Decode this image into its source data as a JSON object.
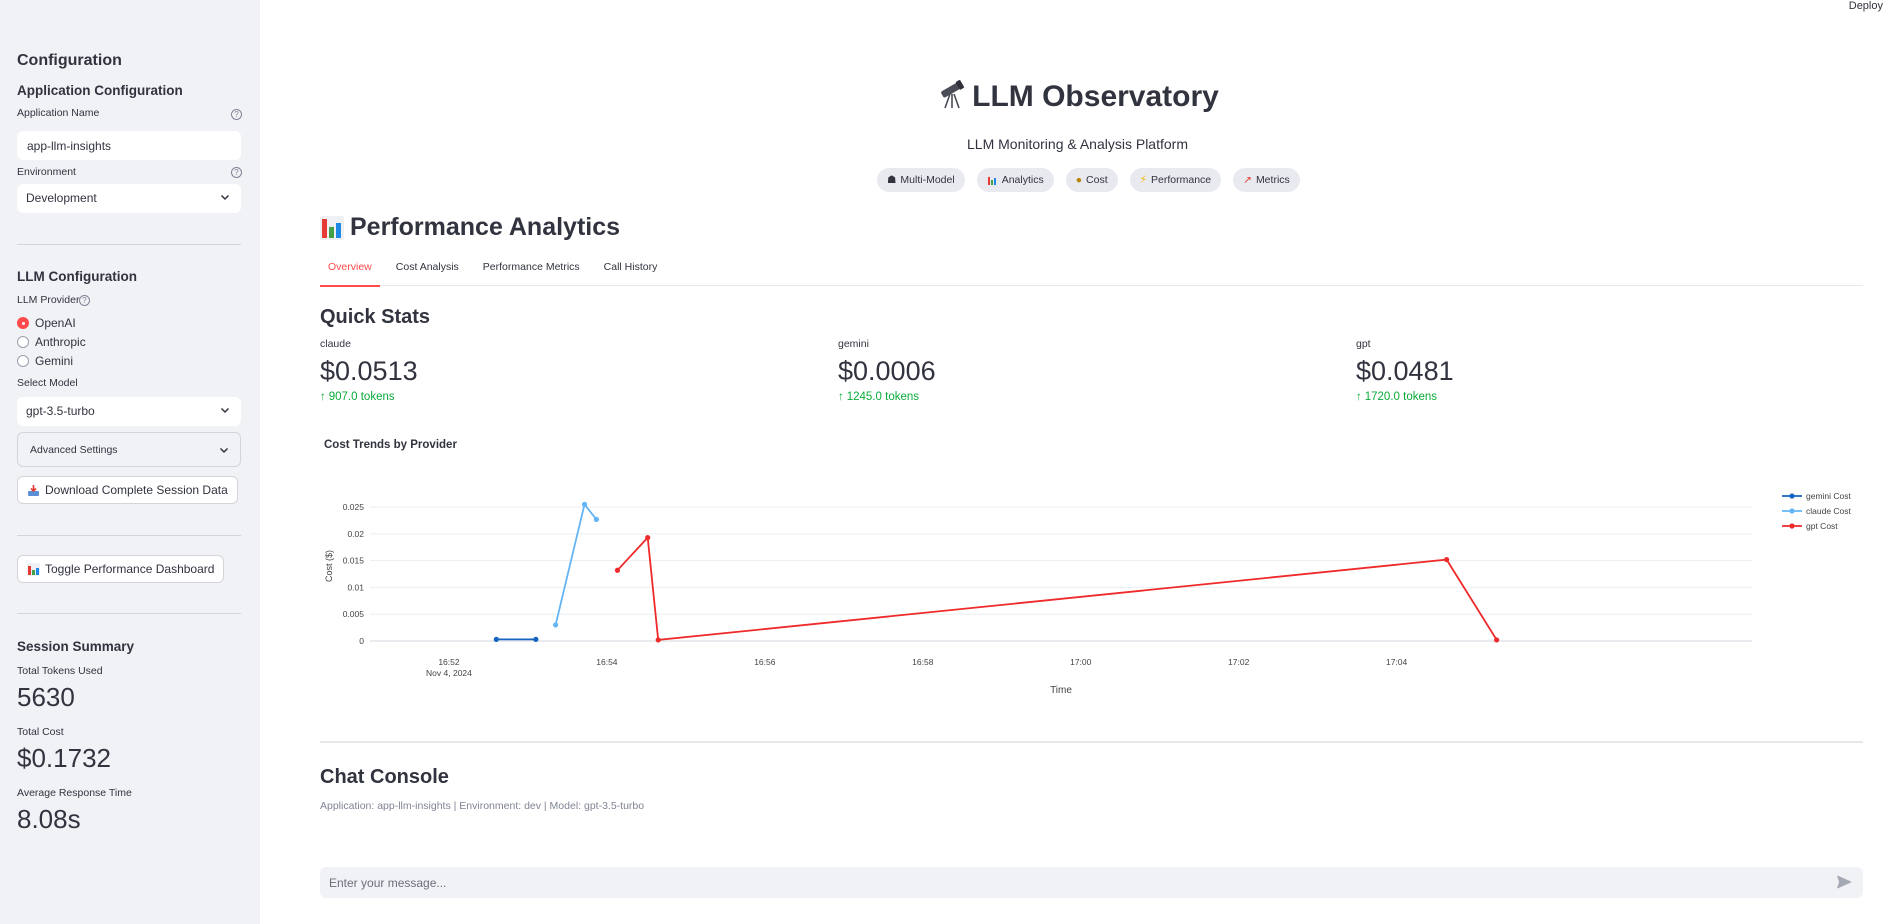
{
  "header": {
    "deploy_label": "Deploy"
  },
  "sidebar": {
    "title": "Configuration",
    "app_config_heading": "Application Configuration",
    "app_name_label": "Application Name",
    "app_name_value": "app-llm-insights",
    "environment_label": "Environment",
    "environment_value": "Development",
    "llm_config_heading": "LLM Configuration",
    "provider_label": "LLM Provider",
    "providers": [
      {
        "label": "OpenAI",
        "selected": true
      },
      {
        "label": "Anthropic",
        "selected": false
      },
      {
        "label": "Gemini",
        "selected": false
      }
    ],
    "model_label": "Select Model",
    "model_value": "gpt-3.5-turbo",
    "advanced_label": "Advanced Settings",
    "download_label": "Download Complete Session Data",
    "toggle_label": "Toggle Performance Dashboard",
    "summary_heading": "Session Summary",
    "tokens_label": "Total Tokens Used",
    "tokens_value": "5630",
    "cost_label": "Total Cost",
    "cost_value": "$0.1732",
    "response_label": "Average Response Time",
    "response_value": "8.08s"
  },
  "main": {
    "title": "LLM Observatory",
    "subtitle": "LLM Monitoring & Analysis Platform",
    "pills": [
      {
        "icon": "robot-icon",
        "label": "Multi-Model"
      },
      {
        "icon": "bar-chart-icon",
        "label": "Analytics"
      },
      {
        "icon": "money-bag-icon",
        "label": "Cost"
      },
      {
        "icon": "lightning-icon",
        "label": "Performance"
      },
      {
        "icon": "trend-icon",
        "label": "Metrics"
      }
    ],
    "section_title": "Performance Analytics",
    "tabs": [
      {
        "label": "Overview",
        "active": true
      },
      {
        "label": "Cost Analysis",
        "active": false
      },
      {
        "label": "Performance Metrics",
        "active": false
      },
      {
        "label": "Call History",
        "active": false
      }
    ],
    "quick_stats_heading": "Quick Stats",
    "stats": [
      {
        "label": "claude",
        "value": "$0.0513",
        "delta": "907.0 tokens"
      },
      {
        "label": "gemini",
        "value": "$0.0006",
        "delta": "1245.0 tokens"
      },
      {
        "label": "gpt",
        "value": "$0.0481",
        "delta": "1720.0 tokens"
      }
    ],
    "chat_heading": "Chat Console",
    "chat_caption": "Application: app-llm-insights | Environment: dev | Model: gpt-3.5-turbo",
    "chat_placeholder": "Enter your message..."
  },
  "colors": {
    "accent": "#ff4b4b",
    "positive": "#09ab3b",
    "gemini": "#1565c0",
    "claude": "#64b5f6",
    "gpt": "#ef2a2a"
  },
  "chart_data": {
    "type": "line",
    "title": "Cost Trends by Provider",
    "xlabel": "Time",
    "ylabel": "Cost ($)",
    "ylim": [
      0,
      0.028
    ],
    "xlim": [
      "2024-11-04T16:51:00",
      "2024-11-04T17:08:30"
    ],
    "y_ticks": [
      0,
      0.005,
      0.01,
      0.015,
      0.02,
      0.025
    ],
    "y_tick_labels": [
      "0",
      "0.005",
      "0.01",
      "0.015",
      "0.02",
      "0.025"
    ],
    "x_ticks": [
      "2024-11-04T16:52:00",
      "2024-11-04T16:54:00",
      "2024-11-04T16:56:00",
      "2024-11-04T16:58:00",
      "2024-11-04T17:00:00",
      "2024-11-04T17:02:00",
      "2024-11-04T17:04:00"
    ],
    "x_tick_labels": [
      "16:52",
      "16:54",
      "16:56",
      "16:58",
      "17:00",
      "17:02",
      "17:04"
    ],
    "x_date_label": "Nov 4, 2024",
    "legend_position": "top-right",
    "grid": true,
    "series": [
      {
        "name": "gemini Cost",
        "color": "#1565c0",
        "points": [
          [
            "2024-11-04T16:52:36",
            0.0003
          ],
          [
            "2024-11-04T16:53:06",
            0.0003
          ]
        ]
      },
      {
        "name": "claude Cost",
        "color": "#64b5f6",
        "points": [
          [
            "2024-11-04T16:53:21",
            0.003
          ],
          [
            "2024-11-04T16:53:43",
            0.0255
          ],
          [
            "2024-11-04T16:53:52",
            0.0227
          ]
        ]
      },
      {
        "name": "gpt Cost",
        "color": "#ef2a2a",
        "points": [
          [
            "2024-11-04T16:54:08",
            0.0132
          ],
          [
            "2024-11-04T16:54:31",
            0.0193
          ],
          [
            "2024-11-04T16:54:39",
            0.0002
          ],
          [
            "2024-11-04T17:04:38",
            0.0152
          ],
          [
            "2024-11-04T17:05:16",
            0.0002
          ]
        ]
      }
    ]
  }
}
